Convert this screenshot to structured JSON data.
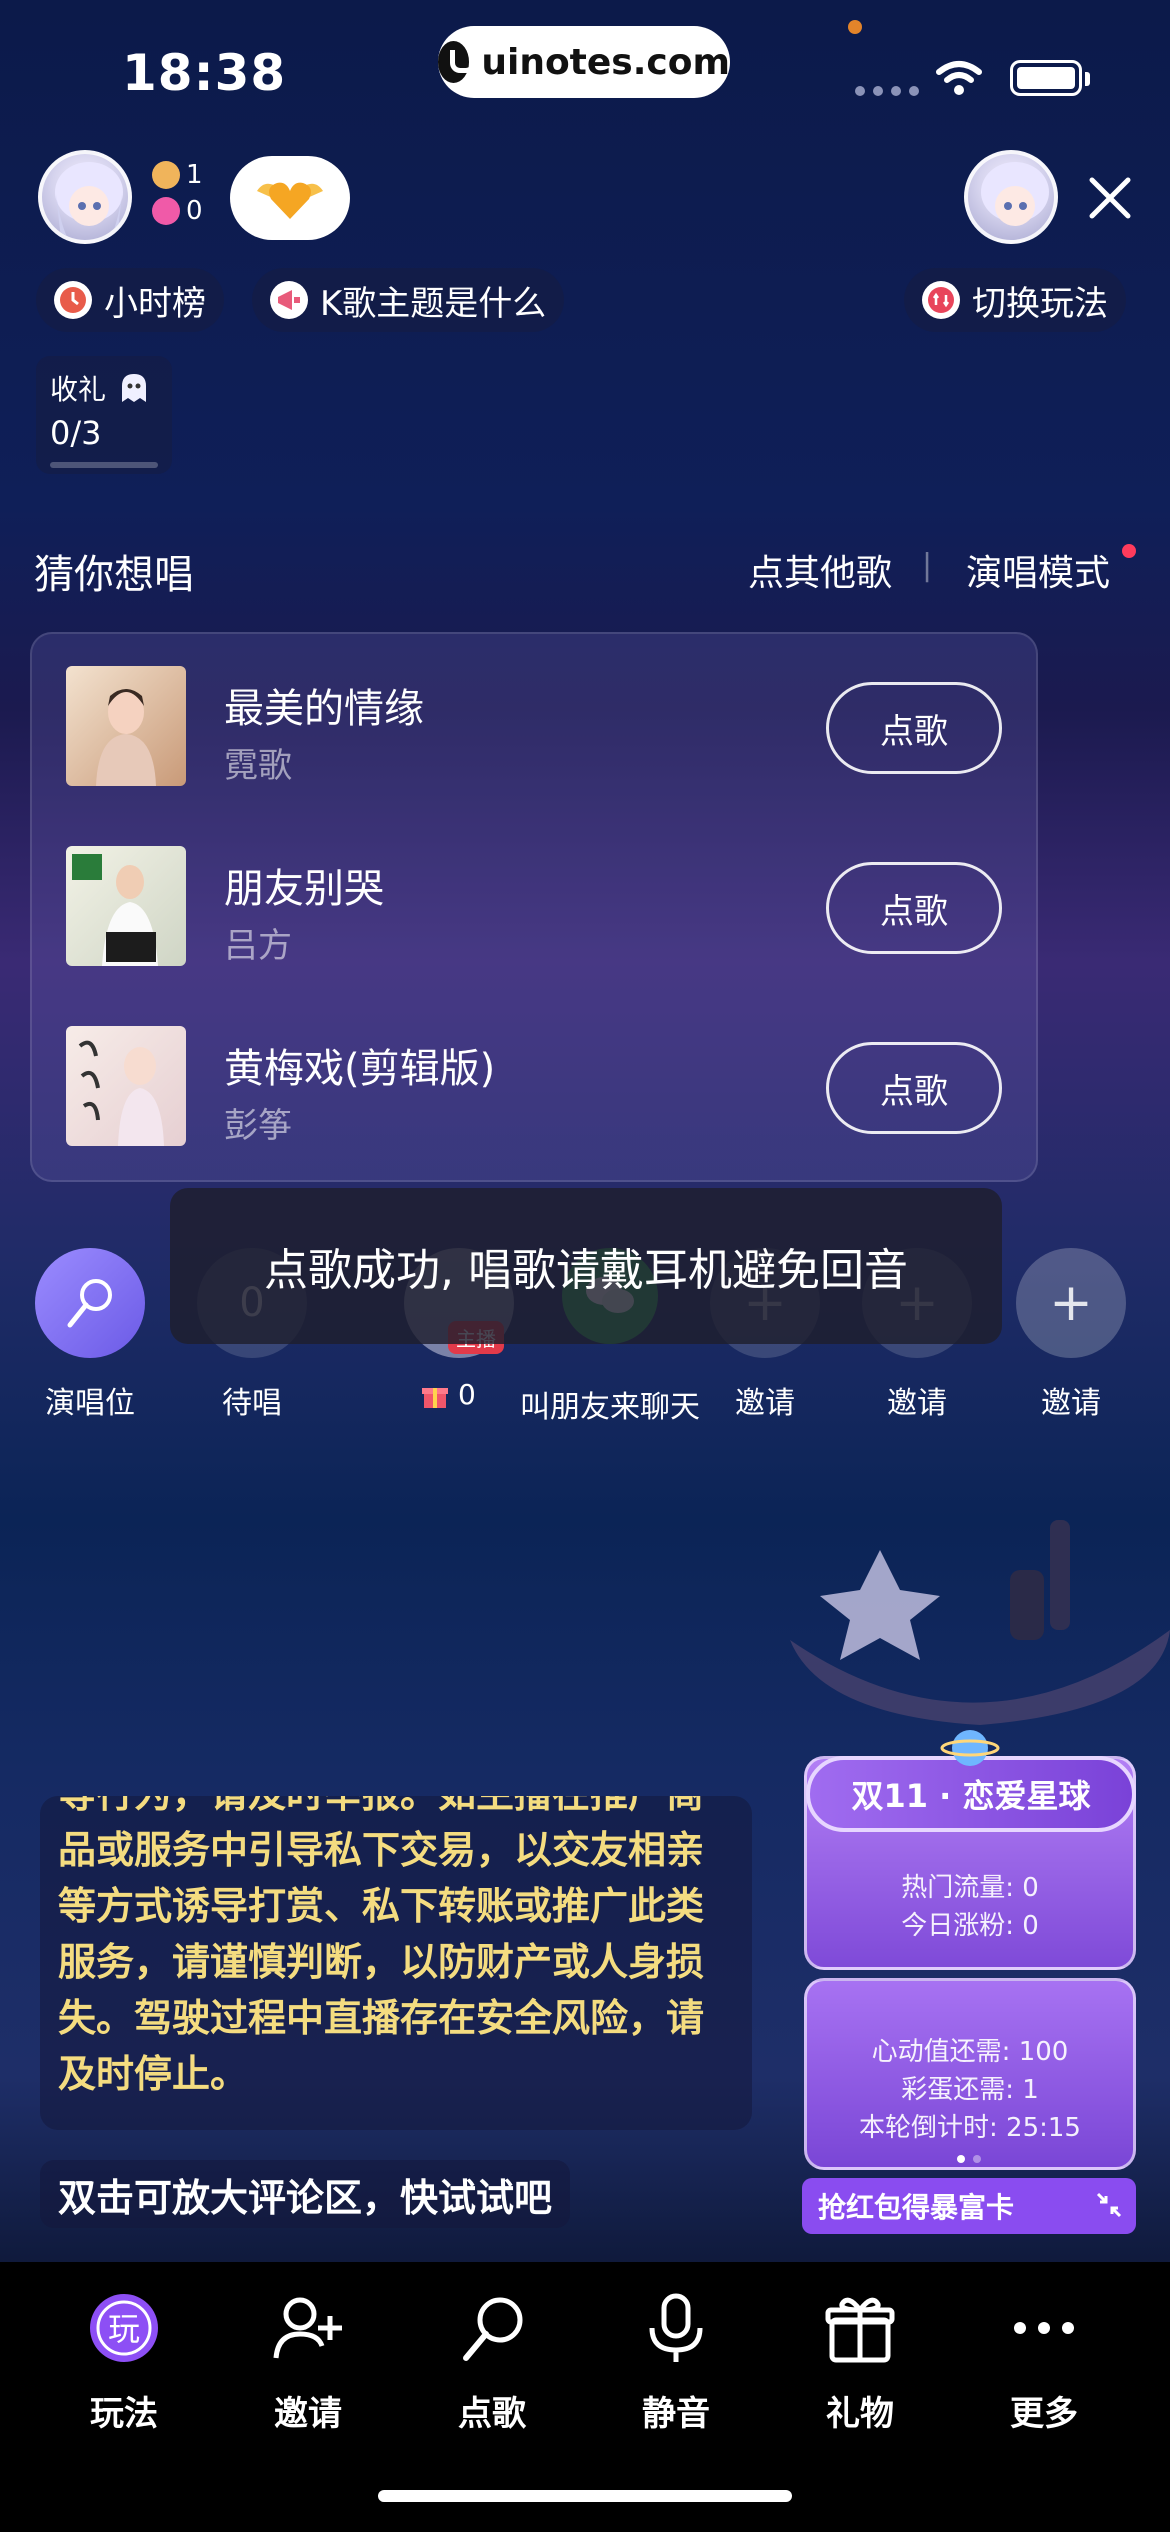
{
  "status_bar": {
    "time": "18:38",
    "watermark": "uinotes.com"
  },
  "host": {
    "followers": "1",
    "likes": "0"
  },
  "top_pills": {
    "hour_rank": "小时榜",
    "topic": "K歌主题是什么",
    "switch_mode": "切换玩法"
  },
  "gift_progress": {
    "label": "收礼",
    "value": "0/3",
    "progress": 0.0
  },
  "song_panel": {
    "title": "猜你想唱",
    "other_songs": "点其他歌",
    "separator": "|",
    "perform_mode": "演唱模式",
    "songs": [
      {
        "title": "最美的情缘",
        "artist": "霓歌",
        "button": "点歌"
      },
      {
        "title": "朋友别哭",
        "artist": "吕方",
        "button": "点歌"
      },
      {
        "title": "黄梅戏(剪辑版)",
        "artist": "彭筝",
        "button": "点歌"
      }
    ]
  },
  "toast": "点歌成功, 唱歌请戴耳机避免回音",
  "seats": {
    "stage": "演唱位",
    "queue_count": "0",
    "queue": "待唱",
    "host_badge": "主播",
    "gift_count": "0",
    "chat_invite": "叫朋友来聊天",
    "invite": "邀请"
  },
  "chat": {
    "notice": "等行为，请及时举报。如主播在推广商品或服务中引导私下交易，以交友相亲等方式诱导打赏、私下转账或推广此类服务，请谨慎判断，以防财产或人身损失。驾驶过程中直播存在安全风险，请及时停止。",
    "hint": "双击可放大评论区，快试试吧"
  },
  "event": {
    "title": "双11 · 恋爱星球",
    "hot_traffic": "热门流量: 0",
    "today_fans": "今日涨粉: 0",
    "heart_needed": "心动值还需: 100",
    "egg_needed": "彩蛋还需: 1",
    "countdown": "本轮倒计时: 25:15",
    "cta": "抢红包得暴富卡"
  },
  "bottom_nav": [
    {
      "label": "玩法",
      "icon": "play-icon"
    },
    {
      "label": "邀请",
      "icon": "add-user-icon"
    },
    {
      "label": "点歌",
      "icon": "microphone-song-icon"
    },
    {
      "label": "静音",
      "icon": "mic-icon"
    },
    {
      "label": "礼物",
      "icon": "gift-icon"
    },
    {
      "label": "更多",
      "icon": "more-icon"
    }
  ],
  "colors": {
    "accent_purple": "#8a4cf0",
    "notice_yellow": "#f4dc80",
    "red_dot": "#ff3b5c"
  }
}
